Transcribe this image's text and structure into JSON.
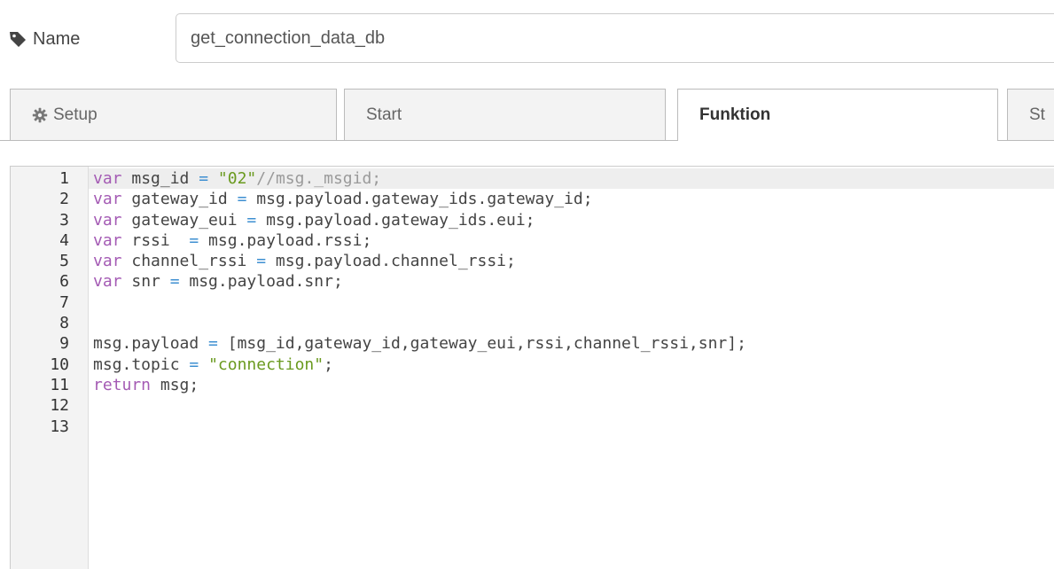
{
  "name_field": {
    "label": "Name",
    "value": "get_connection_data_db"
  },
  "tabs": [
    {
      "label": "Setup",
      "icon": "gear-icon",
      "active": false
    },
    {
      "label": "Start",
      "active": false
    },
    {
      "label": "Funktion",
      "active": true
    },
    {
      "label": "St",
      "active": false
    }
  ],
  "editor": {
    "active_line": 1,
    "lines": [
      {
        "n": "1",
        "tokens": [
          [
            "k",
            "var"
          ],
          [
            "p",
            " msg_id "
          ],
          [
            "o",
            "="
          ],
          [
            "p",
            " "
          ],
          [
            "s",
            "\"02\""
          ],
          [
            "c",
            "//msg._msgid;"
          ]
        ]
      },
      {
        "n": "2",
        "tokens": [
          [
            "k",
            "var"
          ],
          [
            "p",
            " gateway_id "
          ],
          [
            "o",
            "="
          ],
          [
            "p",
            " msg.payload.gateway_ids.gateway_id;"
          ]
        ]
      },
      {
        "n": "3",
        "tokens": [
          [
            "k",
            "var"
          ],
          [
            "p",
            " gateway_eui "
          ],
          [
            "o",
            "="
          ],
          [
            "p",
            " msg.payload.gateway_ids.eui;"
          ]
        ]
      },
      {
        "n": "4",
        "tokens": [
          [
            "k",
            "var"
          ],
          [
            "p",
            " rssi  "
          ],
          [
            "o",
            "="
          ],
          [
            "p",
            " msg.payload.rssi;"
          ]
        ]
      },
      {
        "n": "5",
        "tokens": [
          [
            "k",
            "var"
          ],
          [
            "p",
            " channel_rssi "
          ],
          [
            "o",
            "="
          ],
          [
            "p",
            " msg.payload.channel_rssi;"
          ]
        ]
      },
      {
        "n": "6",
        "tokens": [
          [
            "k",
            "var"
          ],
          [
            "p",
            " snr "
          ],
          [
            "o",
            "="
          ],
          [
            "p",
            " msg.payload.snr;"
          ]
        ]
      },
      {
        "n": "7",
        "tokens": []
      },
      {
        "n": "8",
        "tokens": []
      },
      {
        "n": "9",
        "tokens": [
          [
            "p",
            "msg.payload "
          ],
          [
            "o",
            "="
          ],
          [
            "p",
            " [msg_id,gateway_id,gateway_eui,rssi,channel_rssi,snr];"
          ]
        ]
      },
      {
        "n": "10",
        "tokens": [
          [
            "p",
            "msg.topic "
          ],
          [
            "o",
            "="
          ],
          [
            "p",
            " "
          ],
          [
            "s",
            "\"connection\""
          ],
          [
            "p",
            ";"
          ]
        ]
      },
      {
        "n": "11",
        "tokens": [
          [
            "k",
            "return"
          ],
          [
            "p",
            " msg;"
          ]
        ]
      },
      {
        "n": "12",
        "tokens": []
      },
      {
        "n": "13",
        "tokens": []
      }
    ]
  },
  "colors": {
    "keyword": "#a45bb4",
    "string": "#6a9a1f",
    "comment": "#9a9a9a",
    "operator": "#3d8fd1"
  }
}
